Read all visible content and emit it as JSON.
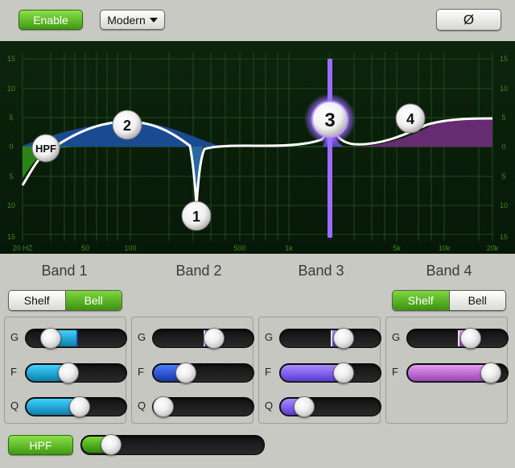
{
  "toolbar": {
    "enable_label": "Enable",
    "mode_label": "Modern",
    "phase_label": "Ø"
  },
  "graph": {
    "db_ticks": [
      "15",
      "10",
      "5",
      "0",
      "5",
      "10",
      "15"
    ],
    "freq_ticks": [
      "20 HZ",
      "50",
      "100",
      "500",
      "1k",
      "5k",
      "10k",
      "20k"
    ],
    "nodes": [
      {
        "label": "HPF"
      },
      {
        "label": "1"
      },
      {
        "label": "2"
      },
      {
        "label": "3"
      },
      {
        "label": "4"
      }
    ],
    "selected_node": "3",
    "colors": {
      "background": "#0f2a0f",
      "grid": "#1f4a1f",
      "tick_text": "#3e8a22",
      "curve": "#ffffff",
      "band1_blue": "#1c4fa0",
      "band2_green": "#2e8a18",
      "band4_purple": "#6b2d77",
      "selected": "#9b6dff"
    }
  },
  "bands": [
    {
      "title": "Band 1",
      "shape_options": [
        "Shelf",
        "Bell"
      ],
      "shape_selected": "Bell",
      "sliders": [
        {
          "label": "G",
          "value": 0.18,
          "fill": "cyan",
          "center_tick": true
        },
        {
          "label": "F",
          "value": 0.4,
          "fill": "cyan"
        },
        {
          "label": "Q",
          "value": 0.53,
          "fill": "cyan"
        }
      ]
    },
    {
      "title": "Band 2",
      "sliders": [
        {
          "label": "G",
          "value": 0.62,
          "fill": "blue",
          "center_tick": true
        },
        {
          "label": "F",
          "value": 0.28,
          "fill": "blue"
        },
        {
          "label": "Q",
          "value": 0.0,
          "fill": "blue"
        }
      ]
    },
    {
      "title": "Band 3",
      "sliders": [
        {
          "label": "G",
          "value": 0.65,
          "fill": "purple",
          "center_tick": true
        },
        {
          "label": "F",
          "value": 0.65,
          "fill": "purple"
        },
        {
          "label": "Q",
          "value": 0.17,
          "fill": "purple"
        }
      ]
    },
    {
      "title": "Band 4",
      "shape_options": [
        "Shelf",
        "Bell"
      ],
      "shape_selected": "Shelf",
      "sliders": [
        {
          "label": "G",
          "value": 0.65,
          "fill": "magenta",
          "center_tick": true
        },
        {
          "label": "F",
          "value": 0.9,
          "fill": "magenta"
        }
      ]
    }
  ],
  "hpf": {
    "label": "HPF",
    "value": 0.12
  }
}
